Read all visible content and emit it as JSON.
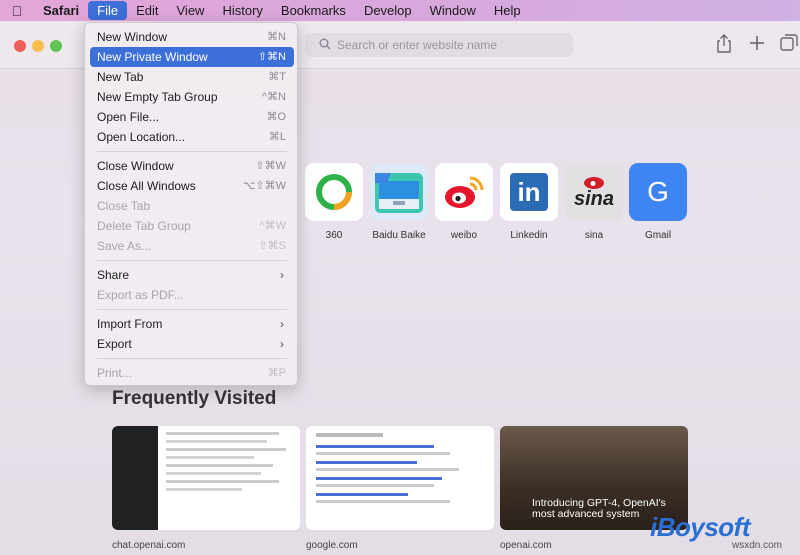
{
  "menubar": {
    "apple_icon": "apple-icon",
    "items": [
      "Safari",
      "File",
      "Edit",
      "View",
      "History",
      "Bookmarks",
      "Develop",
      "Window",
      "Help"
    ]
  },
  "toolbar": {
    "search_placeholder": "Search or enter website name"
  },
  "file_menu": {
    "items": [
      {
        "label": "New Window",
        "shortcut": "⌘N"
      },
      {
        "label": "New Private Window",
        "shortcut": "⇧⌘N"
      },
      {
        "label": "New Tab",
        "shortcut": "⌘T"
      },
      {
        "label": "New Empty Tab Group",
        "shortcut": "^⌘N"
      },
      {
        "label": "Open File...",
        "shortcut": "⌘O"
      },
      {
        "label": "Open Location...",
        "shortcut": "⌘L"
      },
      {
        "label": "Close Window",
        "shortcut": "⇧⌘W"
      },
      {
        "label": "Close All Windows",
        "shortcut": "⌥⇧⌘W"
      },
      {
        "label": "Close Tab",
        "shortcut": ""
      },
      {
        "label": "Delete Tab Group",
        "shortcut": "^⌘W"
      },
      {
        "label": "Save As...",
        "shortcut": "⇧⌘S"
      },
      {
        "label": "Share",
        "shortcut": ""
      },
      {
        "label": "Export as PDF...",
        "shortcut": ""
      },
      {
        "label": "Import From",
        "shortcut": ""
      },
      {
        "label": "Export",
        "shortcut": ""
      },
      {
        "label": "Print...",
        "shortcut": "⌘P"
      }
    ]
  },
  "favorites": [
    {
      "label": "360"
    },
    {
      "label": "Baidu Baike"
    },
    {
      "label": "weibo"
    },
    {
      "label": "Linkedin",
      "tile_text": "in"
    },
    {
      "label": "sina",
      "tile_text": "sina"
    },
    {
      "label": "Gmail",
      "tile_text": "G"
    }
  ],
  "frequently_visited": {
    "title": "Frequently Visited",
    "sites": [
      {
        "label": "chat.openai.com"
      },
      {
        "label": "google.com"
      },
      {
        "label": "openai.com",
        "preview_text": "Introducing GPT-4, OpenAI's most advanced system"
      }
    ]
  },
  "watermark": {
    "brand": "iBoysoft",
    "site": "wsxdn.com"
  }
}
